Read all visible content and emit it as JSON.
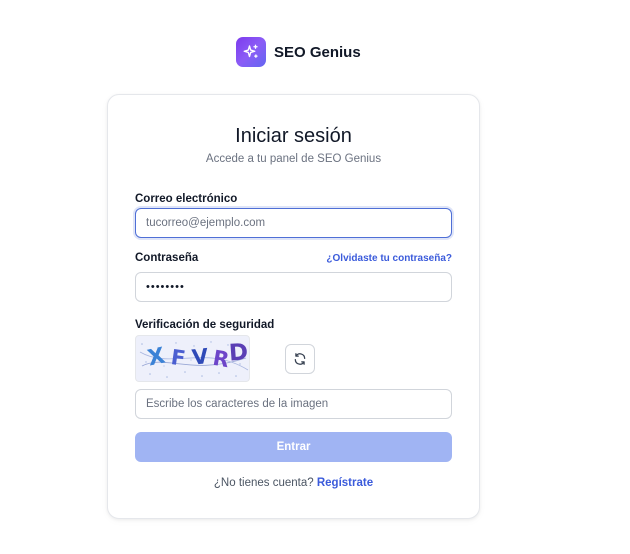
{
  "brand": {
    "name": "SEO Genius",
    "logo_icon": "sparkles-icon",
    "logo_color": "#7c3aed"
  },
  "login": {
    "title": "Iniciar sesión",
    "subtitle": "Accede a tu panel de SEO Genius",
    "email": {
      "label": "Correo electrónico",
      "placeholder": "tucorreo@ejemplo.com"
    },
    "password": {
      "label": "Contraseña",
      "forgot_link": "¿Olvidaste tu contraseña?",
      "value": "••••••••"
    },
    "captcha": {
      "label": "Verificación de seguridad",
      "text": "XFVRD",
      "chars": [
        "X",
        "F",
        "V",
        "R",
        "D"
      ],
      "refresh_icon": "refresh-icon",
      "input_placeholder": "Escribe los caracteres de la imagen"
    },
    "submit_label": "Entrar",
    "signup_prompt": "¿No tienes cuenta?",
    "signup_link": "Regístrate"
  },
  "colors": {
    "accent": "#3b5bdb",
    "submit_disabled": "#a0b4f3",
    "focus_border": "#4f6fd6"
  }
}
